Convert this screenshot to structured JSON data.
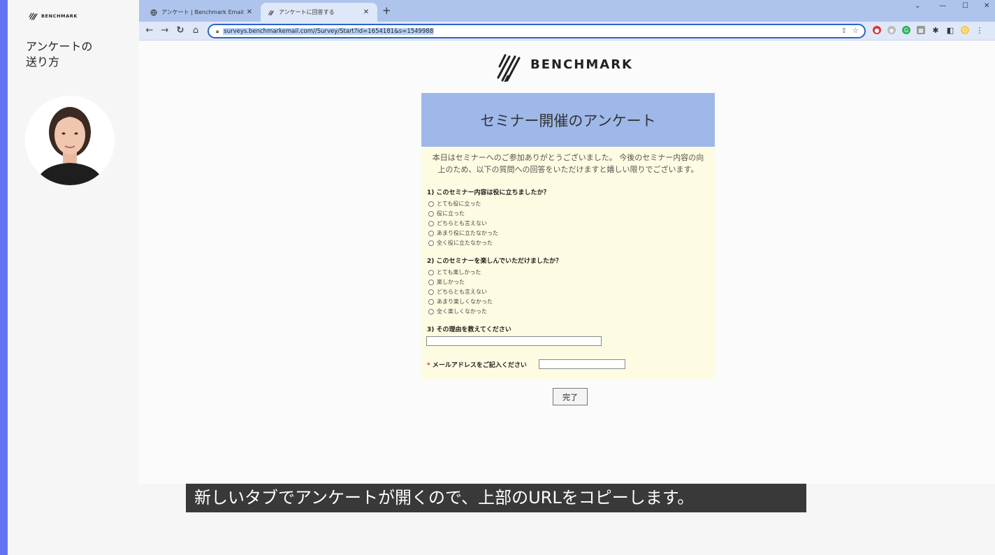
{
  "left_panel": {
    "brand": "BENCHMARK",
    "title_line1": "アンケートの",
    "title_line2": "送り方"
  },
  "browser": {
    "tabs": [
      {
        "label": "アンケート | Benchmark Email",
        "active": false
      },
      {
        "label": "アンケートに回答する",
        "active": true
      }
    ],
    "new_tab": "+",
    "url": "surveys.benchmarkemail.com//Survey/Start?id=1654181&s=1549988"
  },
  "page": {
    "logo_text": "BENCHMARK",
    "survey_title": "セミナー開催のアンケート",
    "intro_line1": "本日はセミナーへのご参加ありがとうございました。 今後のセミナー内容の向",
    "intro_line2": "上のため、以下の質問への回答をいただけますと嬉しい限りでございます。",
    "q1": {
      "label": "1) このセミナー内容は役に立ちましたか？",
      "options": [
        "とても役に立った",
        "役に立った",
        "どちらとも言えない",
        "あまり役に立たなかった",
        "全く役に立たなかった"
      ]
    },
    "q2": {
      "label": "2) このセミナーを楽しんでいただけましたか？",
      "options": [
        "とても楽しかった",
        "楽しかった",
        "どちらとも言えない",
        "あまり楽しくなかった",
        "全く楽しくなかった"
      ]
    },
    "q3": {
      "label": "3) その理由を教えてください",
      "value": ""
    },
    "email": {
      "required_mark": "*",
      "label": "メールアドレスをご記入ください",
      "value": ""
    },
    "submit_label": "完了"
  },
  "subtitle": "新しいタブでアンケートが開くので、上部のURLをコピーします。",
  "colors": {
    "accent": "#6474f0",
    "survey_header": "#9fb8ea",
    "survey_body": "#fdfbe1",
    "tabbar": "#aec4ec"
  }
}
